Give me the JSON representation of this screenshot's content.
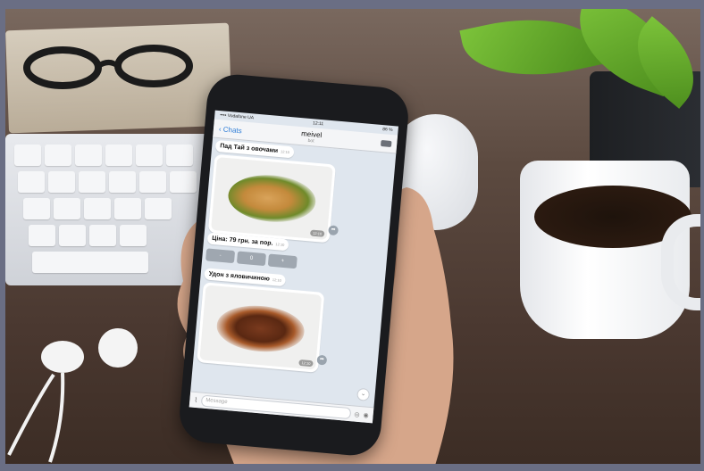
{
  "scene": {
    "accent": "#2b7bd6",
    "frame_color": "#6a6e84"
  },
  "phone": {
    "status": {
      "carrier": "•••• Vodafone UA",
      "time": "12:11",
      "battery": "86 %"
    },
    "nav": {
      "back_label": "Chats",
      "title": "meivel",
      "subtitle": "bot",
      "back_icon": "chevron-left-icon",
      "keyboard_icon": "keyboard-icon"
    },
    "messages": [
      {
        "type": "text",
        "text": "Пад Тай з овочами",
        "time": "12:10"
      },
      {
        "type": "photo",
        "time": "12:10"
      },
      {
        "type": "text",
        "text": "Ціна: 79 грн. за пор.",
        "time": "12:10"
      },
      {
        "type": "buttons",
        "labels": [
          "-",
          "0",
          "+"
        ]
      },
      {
        "type": "text",
        "text": "Удон з яловичиною",
        "time": "12:10"
      },
      {
        "type": "photo",
        "time": "12:10"
      }
    ],
    "input": {
      "placeholder": "Message",
      "attach_icon": "paperclip-icon",
      "sticker_icon": "sticker-icon",
      "mic_icon": "camera-icon"
    }
  }
}
